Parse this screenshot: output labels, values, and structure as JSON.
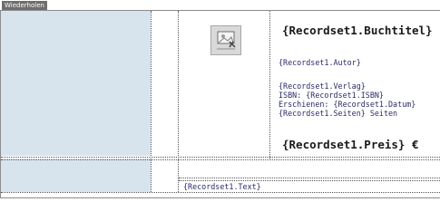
{
  "repeat_region": {
    "label": "Wiederholen"
  },
  "record": {
    "buchtitel": "{Recordset1.Buchtitel}",
    "autor": "{Recordset1.Autor}",
    "verlag": "{Recordset1.Verlag}",
    "isbn": "ISBN: {Recordset1.ISBN}",
    "erschienen": "Erschienen: {Recordset1.Datum}",
    "seiten": "{Recordset1.Seiten} Seiten",
    "preis": "{Recordset1.Preis} €",
    "text": "{Recordset1.Text}"
  },
  "image_placeholder": {
    "icon": "image-icon"
  },
  "colors": {
    "cell_background": "#d8e4ed",
    "tab_background": "#6e6e6e"
  }
}
